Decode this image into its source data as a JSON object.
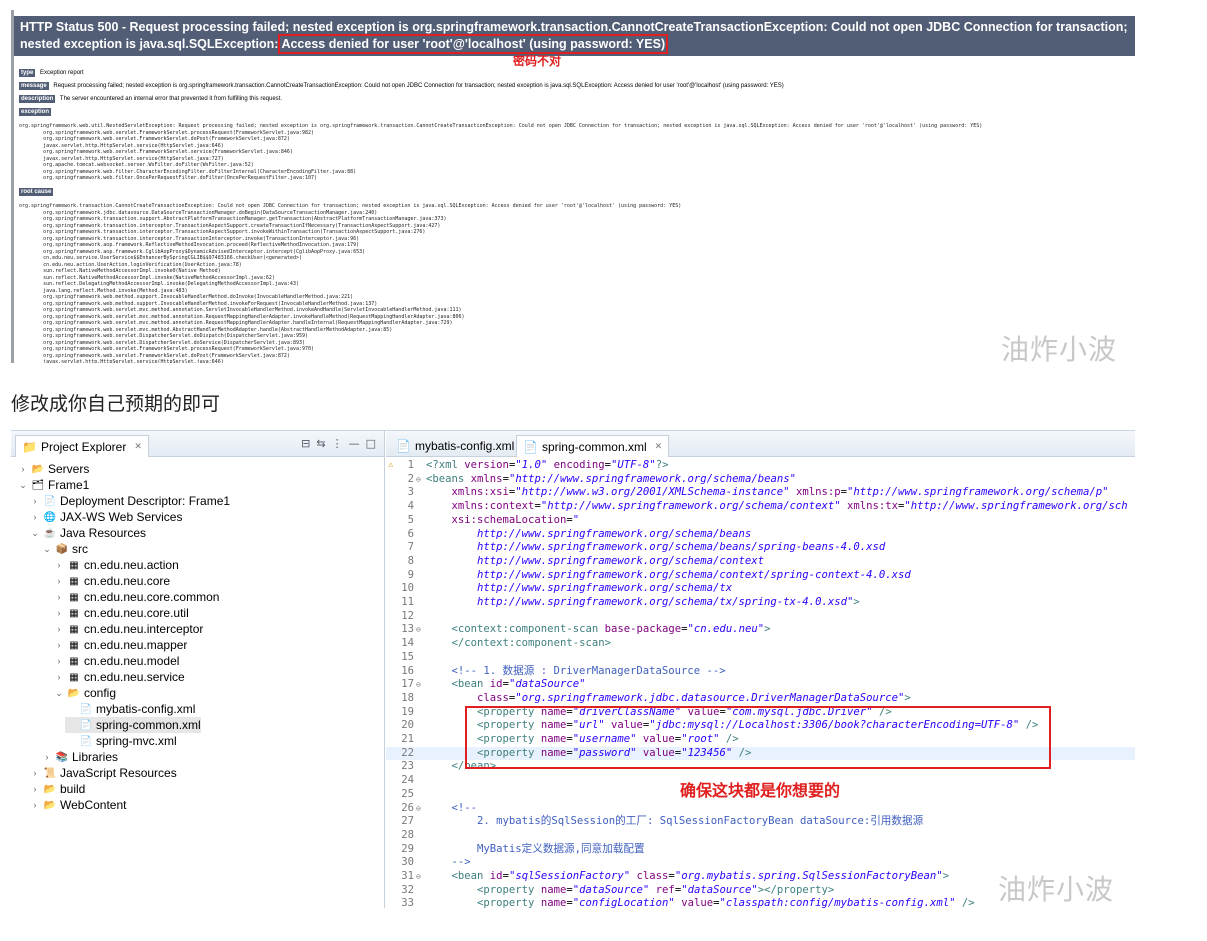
{
  "error_page": {
    "title_pre": "HTTP Status 500 - Request processing failed; nested exception is org.springframework.transaction.CannotCreateTransactionException: Could not open JDBC Connection for transaction; nested exception is",
    "title_ex": "java.sql.SQLException:",
    "title_highlight": "Access denied for user 'root'@'localhost' (using password: YES)",
    "annotation": "密码不对",
    "type_label": "type",
    "type_value": "Exception report",
    "message_label": "message",
    "message_value": "Request processing failed; nested exception is org.springframework.transaction.CannotCreateTransactionException: Could not open JDBC Connection for transaction; nested exception is java.sql.SQLException: Access denied for user 'root'@'localhost' (using password: YES)",
    "description_label": "description",
    "description_value": "The server encountered an internal error that prevented it from fulfilling this request.",
    "exception_label": "exception",
    "exception_trace": "org.springframework.web.util.NestedServletException: Request processing failed; nested exception is org.springframework.transaction.CannotCreateTransactionException: Could not open JDBC Connection for transaction; nested exception is java.sql.SQLException: Access denied for user 'root'@'localhost' (using password: YES)\n\torg.springframework.web.servlet.FrameworkServlet.processRequest(FrameworkServlet.java:982)\n\torg.springframework.web.servlet.FrameworkServlet.doPost(FrameworkServlet.java:872)\n\tjavax.servlet.http.HttpServlet.service(HttpServlet.java:646)\n\torg.springframework.web.servlet.FrameworkServlet.service(FrameworkServlet.java:846)\n\tjavax.servlet.http.HttpServlet.service(HttpServlet.java:727)\n\torg.apache.tomcat.websocket.server.WsFilter.doFilter(WsFilter.java:52)\n\torg.springframework.web.filter.CharacterEncodingFilter.doFilterInternal(CharacterEncodingFilter.java:88)\n\torg.springframework.web.filter.OncePerRequestFilter.doFilter(OncePerRequestFilter.java:107)",
    "root_cause_label": "root cause",
    "root_cause_trace": "org.springframework.transaction.CannotCreateTransactionException: Could not open JDBC Connection for transaction; nested exception is java.sql.SQLException: Access denied for user 'root'@'localhost' (using password: YES)\n\torg.springframework.jdbc.datasource.DataSourceTransactionManager.doBegin(DataSourceTransactionManager.java:240)\n\torg.springframework.transaction.support.AbstractPlatformTransactionManager.getTransaction(AbstractPlatformTransactionManager.java:373)\n\torg.springframework.transaction.interceptor.TransactionAspectSupport.createTransactionIfNecessary(TransactionAspectSupport.java:427)\n\torg.springframework.transaction.interceptor.TransactionAspectSupport.invokeWithinTransaction(TransactionAspectSupport.java:276)\n\torg.springframework.transaction.interceptor.TransactionInterceptor.invoke(TransactionInterceptor.java:96)\n\torg.springframework.aop.framework.ReflectiveMethodInvocation.proceed(ReflectiveMethodInvocation.java:179)\n\torg.springframework.aop.framework.CglibAopProxy$DynamicAdvisedInterceptor.intercept(CglibAopProxy.java:653)\n\tcn.edu.neu.service.UserService$$EnhancerBySpringCGLIB$$97483166.checkUser(<generated>)\n\tcn.edu.neu.action.UserAction.loginVerification(UserAction.java:78)\n\tsun.reflect.NativeMethodAccessorImpl.invoke0(Native Method)\n\tsun.reflect.NativeMethodAccessorImpl.invoke(NativeMethodAccessorImpl.java:62)\n\tsun.reflect.DelegatingMethodAccessorImpl.invoke(DelegatingMethodAccessorImpl.java:43)\n\tjava.lang.reflect.Method.invoke(Method.java:483)\n\torg.springframework.web.method.support.InvocableHandlerMethod.doInvoke(InvocableHandlerMethod.java:221)\n\torg.springframework.web.method.support.InvocableHandlerMethod.invokeForRequest(InvocableHandlerMethod.java:137)\n\torg.springframework.web.servlet.mvc.method.annotation.ServletInvocableHandlerMethod.invokeAndHandle(ServletInvocableHandlerMethod.java:111)\n\torg.springframework.web.servlet.mvc.method.annotation.RequestMappingHandlerAdapter.invokeHandleMethod(RequestMappingHandlerAdapter.java:806)\n\torg.springframework.web.servlet.mvc.method.annotation.RequestMappingHandlerAdapter.handleInternal(RequestMappingHandlerAdapter.java:729)\n\torg.springframework.web.servlet.mvc.method.AbstractHandlerMethodAdapter.handle(AbstractHandlerMethodAdapter.java:85)\n\torg.springframework.web.servlet.DispatcherServlet.doDispatch(DispatcherServlet.java:959)\n\torg.springframework.web.servlet.DispatcherServlet.doService(DispatcherServlet.java:893)\n\torg.springframework.web.servlet.FrameworkServlet.processRequest(FrameworkServlet.java:970)\n\torg.springframework.web.servlet.FrameworkServlet.doPost(FrameworkServlet.java:872)\n\tjavax.servlet.http.HttpServlet.service(HttpServlet.java:646)"
  },
  "watermark": "油炸小波",
  "caption": "修改成你自己预期的即可",
  "ide": {
    "project_explorer_title": "Project Explorer",
    "tree": [
      {
        "label": "Servers",
        "level": 0,
        "twisty": "›",
        "icon": "folder-icon"
      },
      {
        "label": "Frame1",
        "level": 0,
        "twisty": "⌄",
        "icon": "project-icon"
      },
      {
        "label": "Deployment Descriptor: Frame1",
        "level": 1,
        "twisty": "›",
        "icon": "descriptor-icon"
      },
      {
        "label": "JAX-WS Web Services",
        "level": 1,
        "twisty": "›",
        "icon": "webservice-icon"
      },
      {
        "label": "Java Resources",
        "level": 1,
        "twisty": "⌄",
        "icon": "java-resources-icon"
      },
      {
        "label": "src",
        "level": 2,
        "twisty": "⌄",
        "icon": "source-folder-icon"
      },
      {
        "label": "cn.edu.neu.action",
        "level": 3,
        "twisty": "›",
        "icon": "package-icon"
      },
      {
        "label": "cn.edu.neu.core",
        "level": 3,
        "twisty": "›",
        "icon": "package-icon"
      },
      {
        "label": "cn.edu.neu.core.common",
        "level": 3,
        "twisty": "›",
        "icon": "package-icon"
      },
      {
        "label": "cn.edu.neu.core.util",
        "level": 3,
        "twisty": "›",
        "icon": "package-icon"
      },
      {
        "label": "cn.edu.neu.interceptor",
        "level": 3,
        "twisty": "›",
        "icon": "package-icon"
      },
      {
        "label": "cn.edu.neu.mapper",
        "level": 3,
        "twisty": "›",
        "icon": "package-icon"
      },
      {
        "label": "cn.edu.neu.model",
        "level": 3,
        "twisty": "›",
        "icon": "package-icon"
      },
      {
        "label": "cn.edu.neu.service",
        "level": 3,
        "twisty": "›",
        "icon": "package-icon"
      },
      {
        "label": "config",
        "level": 3,
        "twisty": "⌄",
        "icon": "folder-icon"
      },
      {
        "label": "mybatis-config.xml",
        "level": 4,
        "twisty": "",
        "icon": "xml-file-icon"
      },
      {
        "label": "spring-common.xml",
        "level": 4,
        "twisty": "",
        "icon": "xml-file-icon",
        "selected": true
      },
      {
        "label": "spring-mvc.xml",
        "level": 4,
        "twisty": "",
        "icon": "xml-file-icon"
      },
      {
        "label": "Libraries",
        "level": 2,
        "twisty": "›",
        "icon": "library-icon"
      },
      {
        "label": "JavaScript Resources",
        "level": 1,
        "twisty": "›",
        "icon": "js-resources-icon"
      },
      {
        "label": "build",
        "level": 1,
        "twisty": "›",
        "icon": "folder-icon"
      },
      {
        "label": "WebContent",
        "level": 1,
        "twisty": "›",
        "icon": "folder-icon"
      }
    ],
    "editor_tabs": [
      {
        "label": "mybatis-config.xml",
        "active": false
      },
      {
        "label": "spring-common.xml",
        "active": true
      }
    ],
    "code_lines": [
      {
        "n": "1",
        "html": "<span class='tag'>&lt;?xml</span> <span class='attr'>version</span>=<span class='val'>\"1.0\"</span> <span class='attr'>encoding</span>=<span class='val'>\"UTF-8\"</span><span class='tag'>?&gt;</span>"
      },
      {
        "n": "2",
        "html": "<span class='tag'>&lt;beans</span> <span class='attr'>xmlns</span>=<span class='val'>\"http://www.springframework.org/schema/beans\"</span>"
      },
      {
        "n": "3",
        "html": "    <span class='attr'>xmlns:xsi</span>=<span class='val'>\"http://www.w3.org/2001/XMLSchema-instance\"</span> <span class='attr'>xmlns:p</span>=<span class='val'>\"http://www.springframework.org/schema/p\"</span>"
      },
      {
        "n": "4",
        "html": "    <span class='attr'>xmlns:context</span>=<span class='val'>\"http://www.springframework.org/schema/context\"</span> <span class='attr'>xmlns:tx</span>=<span class='val'>\"http://www.springframework.org/sch</span>"
      },
      {
        "n": "5",
        "html": "    <span class='attr'>xsi:schemaLocation</span>=<span class='val'>\"</span>"
      },
      {
        "n": "6",
        "html": "        <span class='val'>http://www.springframework.org/schema/beans</span>"
      },
      {
        "n": "7",
        "html": "        <span class='val'>http://www.springframework.org/schema/beans/spring-beans-4.0.xsd</span>"
      },
      {
        "n": "8",
        "html": "        <span class='val'>http://www.springframework.org/schema/context</span>"
      },
      {
        "n": "9",
        "html": "        <span class='val'>http://www.springframework.org/schema/context/spring-context-4.0.xsd</span>"
      },
      {
        "n": "10",
        "html": "        <span class='val'>http://www.springframework.org/schema/tx</span>"
      },
      {
        "n": "11",
        "html": "        <span class='val'>http://www.springframework.org/schema/tx/spring-tx-4.0.xsd\"</span><span class='tag'>&gt;</span>"
      },
      {
        "n": "12",
        "html": ""
      },
      {
        "n": "13",
        "html": "    <span class='tag'>&lt;context:component-scan</span> <span class='attr'>base-package</span>=<span class='val'>\"cn.edu.neu\"</span><span class='tag'>&gt;</span>"
      },
      {
        "n": "14",
        "html": "    <span class='tag'>&lt;/context:component-scan&gt;</span>"
      },
      {
        "n": "15",
        "html": ""
      },
      {
        "n": "16",
        "html": "    <span class='cmt'>&lt;!-- 1. 数据源 : DriverManagerDataSource --&gt;</span>"
      },
      {
        "n": "17",
        "html": "    <span class='tag'>&lt;bean</span> <span class='attr'>id</span>=<span class='val'>\"dataSource\"</span>"
      },
      {
        "n": "18",
        "html": "        <span class='attr'>class</span>=<span class='val'>\"org.springframework.jdbc.datasource.DriverManagerDataSource\"</span><span class='tag'>&gt;</span>"
      },
      {
        "n": "19",
        "html": "        <span class='tag'>&lt;property</span> <span class='attr'>name</span>=<span class='val'>\"driverClassName\"</span> <span class='attr'>value</span>=<span class='val'>\"com.mysql.jdbc.Driver\"</span> <span class='tag'>/&gt;</span>"
      },
      {
        "n": "20",
        "html": "        <span class='tag'>&lt;property</span> <span class='attr'>name</span>=<span class='val'>\"url\"</span> <span class='attr'>value</span>=<span class='val'>\"jdbc:mysql://Localhost:3306/book?characterEncoding=UTF-8\"</span> <span class='tag'>/&gt;</span>"
      },
      {
        "n": "21",
        "html": "        <span class='tag'>&lt;property</span> <span class='attr'>name</span>=<span class='val'>\"username\"</span> <span class='attr'>value</span>=<span class='val'>\"root\"</span> <span class='tag'>/&gt;</span>"
      },
      {
        "n": "22",
        "html": "        <span class='tag'>&lt;property</span> <span class='attr'>name</span>=<span class='val'>\"password\"</span> <span class='attr'>value</span>=<span class='val'>\"123456\"</span> <span class='tag'>/&gt;</span>",
        "current": true
      },
      {
        "n": "23",
        "html": "    <span class='tag'>&lt;/bean&gt;</span>"
      },
      {
        "n": "24",
        "html": ""
      },
      {
        "n": "25",
        "html": ""
      },
      {
        "n": "26",
        "html": "    <span class='cmt'>&lt;!--</span>"
      },
      {
        "n": "27",
        "html": "        <span class='cmt'>2. mybatis的SqlSession的工厂: SqlSessionFactoryBean dataSource:引用数据源</span>"
      },
      {
        "n": "28",
        "html": ""
      },
      {
        "n": "29",
        "html": "        <span class='cmt'>MyBatis定义数据源,同意加载配置</span>"
      },
      {
        "n": "30",
        "html": "    <span class='cmt'>--&gt;</span>"
      },
      {
        "n": "31",
        "html": "    <span class='tag'>&lt;bean</span> <span class='attr'>id</span>=<span class='val'>\"sqlSessionFactory\"</span> <span class='attr'>class</span>=<span class='val'>\"org.mybatis.spring.SqlSessionFactoryBean\"</span><span class='tag'>&gt;</span>"
      },
      {
        "n": "32",
        "html": "        <span class='tag'>&lt;property</span> <span class='attr'>name</span>=<span class='val'>\"dataSource\"</span> <span class='attr'>ref</span>=<span class='val'>\"dataSource\"</span><span class='tag'>&gt;&lt;/property&gt;</span>"
      },
      {
        "n": "33",
        "html": "        <span class='tag'>&lt;property</span> <span class='attr'>name</span>=<span class='val'>\"configLocation\"</span> <span class='attr'>value</span>=<span class='val'>\"classpath:config/mybatis-config.xml\"</span> <span class='tag'>/&gt;</span>"
      }
    ],
    "fold_lines": [
      "2",
      "13",
      "17",
      "26",
      "31"
    ],
    "highlight_note": "确保这块都是你想要的"
  }
}
